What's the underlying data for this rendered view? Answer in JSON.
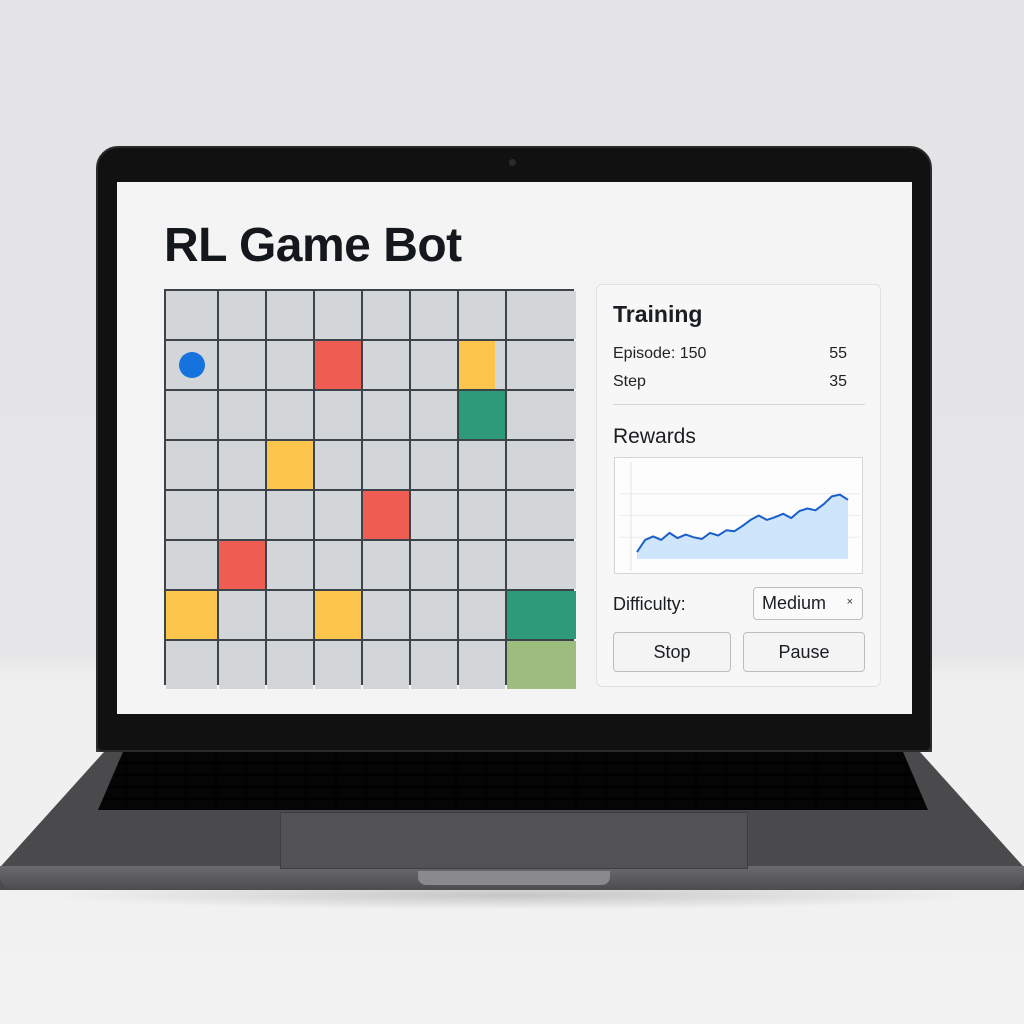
{
  "app": {
    "title": "RL Game Bot"
  },
  "board": {
    "rows": 8,
    "cols": 8,
    "agent_position": [
      1,
      0
    ],
    "colors": {
      "red": "#ee5c52",
      "yellow": "#fbc54c",
      "green": "#2e9a78",
      "lightgreen": "#9dbd7f",
      "empty": "#d3d6d8",
      "agent": "#1673de"
    },
    "cells": [
      [
        "",
        "",
        "",
        "",
        "",
        "",
        "",
        ""
      ],
      [
        "agent",
        "",
        "",
        "red",
        "",
        "",
        "half-yellow",
        ""
      ],
      [
        "",
        "",
        "",
        "",
        "",
        "",
        "green",
        ""
      ],
      [
        "",
        "",
        "yellow",
        "",
        "",
        "",
        "",
        ""
      ],
      [
        "",
        "",
        "",
        "",
        "red",
        "",
        "",
        ""
      ],
      [
        "",
        "red",
        "",
        "",
        "",
        "",
        "",
        ""
      ],
      [
        "yellow",
        "",
        "",
        "yellow",
        "",
        "",
        "",
        "green"
      ],
      [
        "",
        "",
        "",
        "",
        "",
        "",
        "",
        "lightgreen"
      ]
    ]
  },
  "panel": {
    "heading": "Training",
    "stats": [
      {
        "label": "Episode: 150",
        "value": "55"
      },
      {
        "label": "Step",
        "value": "35"
      }
    ],
    "rewards_heading": "Rewards",
    "difficulty_label": "Difficulty:",
    "difficulty_value": "Medium",
    "difficulty_caret": "×",
    "buttons": {
      "stop": "Stop",
      "pause": "Pause"
    }
  },
  "chart_data": {
    "type": "area",
    "title": "",
    "xlabel": "",
    "ylabel": "",
    "grid": true,
    "x": [
      0,
      1,
      2,
      3,
      4,
      5,
      6,
      7,
      8,
      9,
      10,
      11,
      12,
      13,
      14,
      15,
      16,
      17,
      18,
      19,
      20,
      21,
      22,
      23,
      24,
      25,
      26
    ],
    "values": [
      8,
      22,
      26,
      22,
      30,
      24,
      28,
      25,
      23,
      30,
      27,
      33,
      32,
      38,
      45,
      50,
      45,
      48,
      52,
      47,
      55,
      58,
      56,
      63,
      72,
      74,
      68
    ],
    "ylim": [
      0,
      100
    ],
    "colors": {
      "line": "#1a5fc9",
      "fill": "#cfe5fb"
    }
  }
}
